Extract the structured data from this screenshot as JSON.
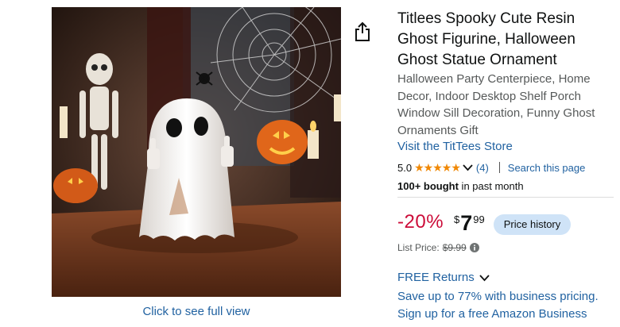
{
  "product": {
    "title": "Titlees Spooky Cute Resin Ghost Figurine, Halloween Ghost Statue Ornament",
    "subtitle": "Halloween Party Centerpiece, Home Decor, Indoor Desktop Shelf Porch Window Sill Decoration, Funny Ghost Ornaments Gift",
    "store_link": "Visit the TitTees Store"
  },
  "image": {
    "full_view_label": "Click to see full view"
  },
  "rating": {
    "value": "5.0",
    "stars": 5,
    "count": "(4)",
    "search_label": "Search this page"
  },
  "bought": {
    "bold": "100+ bought",
    "rest": " in past month"
  },
  "pricing": {
    "discount": "-20%",
    "currency": "$",
    "whole": "7",
    "fraction": "99",
    "price_history_label": "Price history",
    "list_price_label": "List Price:",
    "list_price_value": "$9.99"
  },
  "returns": {
    "label": "FREE Returns"
  },
  "business": {
    "line1": "Save up to 77% with business pricing.",
    "line2": "Sign up for a free Amazon Business"
  },
  "colors": {
    "link": "#2162a1",
    "discount": "#cc0c39",
    "star": "#f08804",
    "price_history_bg": "#cfe3f7"
  }
}
